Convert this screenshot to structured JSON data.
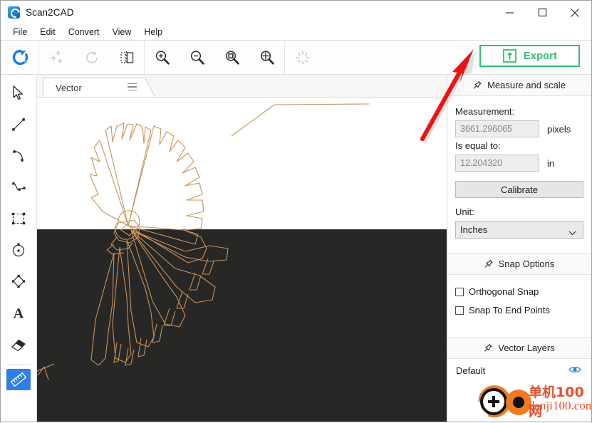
{
  "window": {
    "title": "Scan2CAD",
    "app_icon": "scan2cad-logo-icon",
    "minimize": "minimize-icon",
    "maximize": "maximize-icon",
    "close": "close-icon"
  },
  "menubar": {
    "items": [
      {
        "label": "File"
      },
      {
        "label": "Edit"
      },
      {
        "label": "Convert"
      },
      {
        "label": "View"
      },
      {
        "label": "Help"
      }
    ]
  },
  "toolbar": {
    "buttons": [
      {
        "name": "convert-icon",
        "enabled": true
      },
      {
        "name": "auto-enhance-icon",
        "enabled": false
      },
      {
        "name": "rotate-icon",
        "enabled": false
      },
      {
        "name": "mirror-flip-icon",
        "enabled": true
      },
      {
        "name": "zoom-in-icon",
        "enabled": true
      },
      {
        "name": "zoom-out-icon",
        "enabled": true
      },
      {
        "name": "zoom-fit-icon",
        "enabled": true
      },
      {
        "name": "zoom-selection-icon",
        "enabled": true
      },
      {
        "name": "loading-spinner-icon",
        "enabled": false
      }
    ],
    "export_label": "Export",
    "export_icon": "upload-arrow-icon",
    "export_color": "#2fbf71"
  },
  "tools": {
    "items": [
      {
        "name": "select-tool",
        "icon": "cursor-arrow-icon",
        "active": false
      },
      {
        "name": "line-tool",
        "icon": "line-icon",
        "active": false
      },
      {
        "name": "arc-tool",
        "icon": "arc-icon",
        "active": false
      },
      {
        "name": "spline-tool",
        "icon": "spline-icon",
        "active": false
      },
      {
        "name": "rectangle-tool",
        "icon": "rectangle-icon",
        "active": false
      },
      {
        "name": "circle-tool",
        "icon": "circle-icon",
        "active": false
      },
      {
        "name": "polygon-tool",
        "icon": "diamond-icon",
        "active": false
      },
      {
        "name": "text-tool",
        "icon": "text-a-icon",
        "active": false
      },
      {
        "name": "eraser-tool",
        "icon": "eraser-icon",
        "active": false
      },
      {
        "name": "measure-tool",
        "icon": "ruler-icon",
        "active": true
      }
    ],
    "active_color": "#2f7fe8"
  },
  "tab": {
    "label": "Vector",
    "menu_icon": "hamburger-menu-icon"
  },
  "canvas": {
    "background_light": "#ffffff",
    "background_dark": "#272726",
    "vector_color": "#c8925c",
    "drawing": "fan-shell-vector-drawing"
  },
  "annotation": {
    "arrow": "red-pointer-arrow",
    "color": "#e81414"
  },
  "measure_panel": {
    "header": "Measure and scale",
    "pin_icon": "pin-icon",
    "measurement_label": "Measurement:",
    "measurement_value": "3661.296065",
    "measurement_unit": "pixels",
    "equal_label": "Is equal to:",
    "equal_value": "12.204320",
    "equal_unit": "in",
    "calibrate_label": "Calibrate",
    "unit_label": "Unit:",
    "unit_value": "Inches",
    "chevron_icon": "chevron-down-icon"
  },
  "snap_panel": {
    "header": "Snap Options",
    "pin_icon": "pin-icon",
    "options": [
      {
        "label": "Orthogonal Snap",
        "checked": false
      },
      {
        "label": "Snap To End Points",
        "checked": false
      }
    ]
  },
  "layers_panel": {
    "header": "Vector Layers",
    "pin_icon": "pin-icon",
    "layers": [
      {
        "name": "Default",
        "visible": true,
        "eye_icon": "eye-visible-icon"
      }
    ]
  },
  "watermark": {
    "chinese": "单机100网",
    "domain": "danji100.com",
    "logo": "danji100-circles-logo",
    "color": "#e8502a"
  }
}
